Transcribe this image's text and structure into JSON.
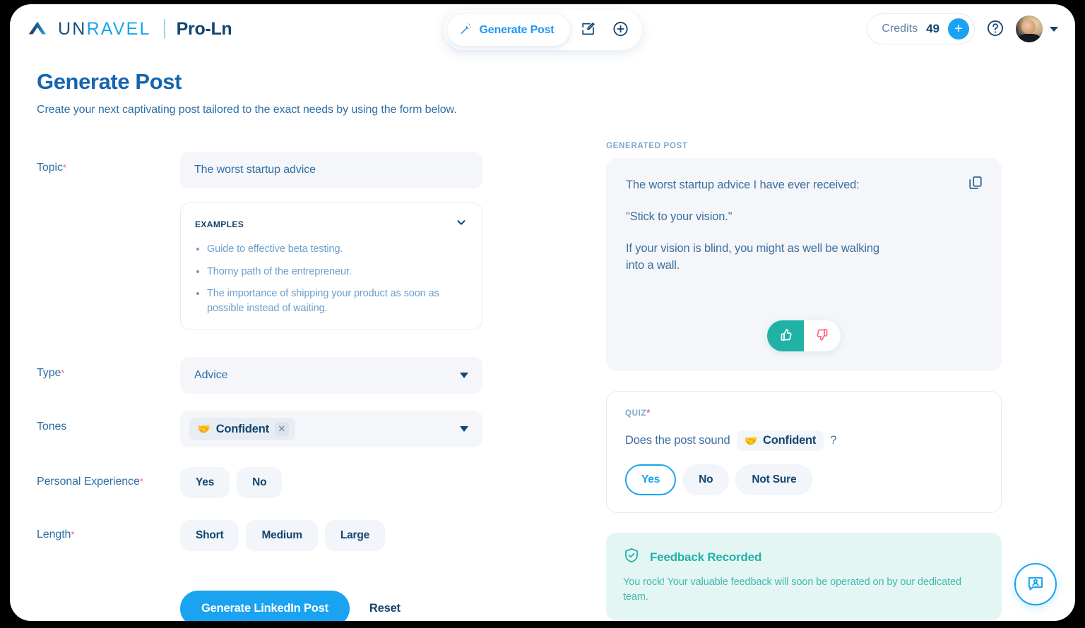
{
  "header": {
    "brand_primary_a": "UN",
    "brand_primary_b": "RAVEL",
    "brand_sub": "Pro-Ln",
    "generate_post_label": "Generate Post",
    "wand_icon": "magic-wand-icon",
    "edit_icon": "edit-square-icon",
    "add_icon": "plus-circle-icon",
    "credits_label": "Credits",
    "credits_value": "49",
    "credits_add_label": "+",
    "help_icon": "question-circle-icon",
    "avatar_icon": "user-avatar"
  },
  "page": {
    "title": "Generate Post",
    "subtitle": "Create your next captivating post tailored to the exact needs by using the form below."
  },
  "form": {
    "topic": {
      "label": "Topic",
      "required": "*",
      "value": "The worst startup advice",
      "placeholder": "The worst startup advice"
    },
    "examples": {
      "title": "EXAMPLES",
      "chevron_icon": "chevron-down-icon",
      "items": [
        "Guide to effective beta testing.",
        "Thorny path of the entrepreneur.",
        "The importance of shipping your product as soon as possible instead of waiting."
      ]
    },
    "type": {
      "label": "Type",
      "required": "*",
      "value": "Advice"
    },
    "tones": {
      "label": "Tones",
      "chip_emoji": "🤝",
      "chip_label": "Confident",
      "chip_remove": "✕"
    },
    "personal_experience": {
      "label": "Personal Experience",
      "required": "*",
      "options": [
        "Yes",
        "No"
      ]
    },
    "length": {
      "label": "Length",
      "required": "*",
      "options": [
        "Short",
        "Medium",
        "Large"
      ]
    },
    "submit_label": "Generate LinkedIn Post",
    "reset_label": "Reset"
  },
  "generated": {
    "section_label": "GENERATED POST",
    "copy_icon": "copy-icon",
    "paragraphs": [
      "The worst startup advice I have ever received:",
      "\"Stick to your vision.\"",
      "If your vision is blind, you might as well be walking into a wall."
    ],
    "thumbs_up_icon": "thumbs-up-icon",
    "thumbs_down_icon": "thumbs-down-icon"
  },
  "quiz": {
    "label": "QUIZ",
    "required": "*",
    "question_prefix": "Does the post sound",
    "chip_emoji": "🤝",
    "chip_label": "Confident",
    "question_suffix": "?",
    "options": [
      "Yes",
      "No",
      "Not Sure"
    ],
    "selected": "Yes"
  },
  "feedback_banner": {
    "shield_icon": "shield-check-icon",
    "title": "Feedback Recorded",
    "body": "You rock! Your valuable feedback will soon be operated on by our dedicated team."
  },
  "chat_fab": {
    "icon": "chat-support-icon"
  },
  "colors": {
    "accent_blue": "#1aa3f0",
    "deep_blue": "#13456f",
    "teal": "#21b2a6",
    "red": "#ff5c7a"
  }
}
